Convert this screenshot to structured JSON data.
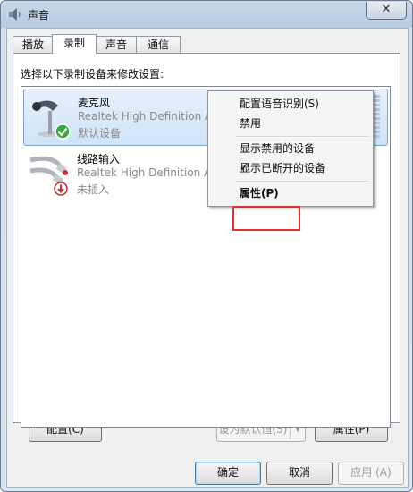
{
  "window": {
    "title": "声音",
    "close_label": "✕"
  },
  "tabs": [
    {
      "label": "播放"
    },
    {
      "label": "录制"
    },
    {
      "label": "声音"
    },
    {
      "label": "通信"
    }
  ],
  "active_tab": "录制",
  "instruction": "选择以下录制设备来修改设置:",
  "devices": [
    {
      "name": "麦克风",
      "description": "Realtek High Definition Audio",
      "status": "默认设备",
      "icon": "microphone-icon",
      "badge": "default-check-icon"
    },
    {
      "name": "线路输入",
      "description": "Realtek High Definition Audio",
      "status": "未插入",
      "icon": "line-in-cable-icon",
      "badge": "unplugged-icon"
    }
  ],
  "context_menu": {
    "items": [
      {
        "label": "配置语音识别(S)"
      },
      {
        "label": "禁用"
      },
      {
        "label": "显示禁用的设备"
      },
      {
        "label": "显示已断开的设备",
        "checked": true
      },
      {
        "label": "属性(P)",
        "bold": true
      }
    ]
  },
  "buttons": {
    "configure": "配置(C)",
    "set_default": "设为默认值(S)",
    "properties": "属性(P)",
    "ok": "确定",
    "cancel": "取消",
    "apply": "应用 (A)"
  },
  "colors": {
    "highlight_box": "#e03030",
    "selection": "#cfe3f8"
  }
}
